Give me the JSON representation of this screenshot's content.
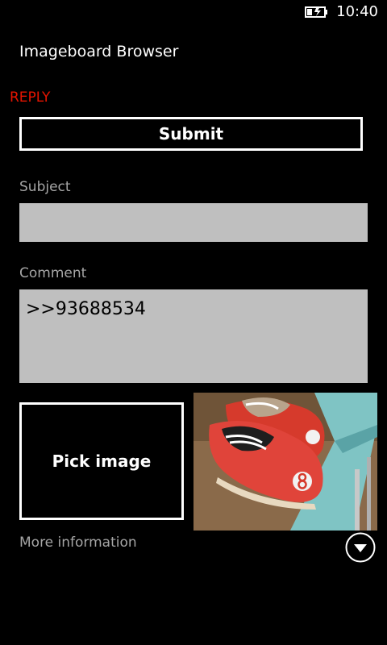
{
  "status_bar": {
    "time": "10:40",
    "battery_icon": "battery-charging-icon"
  },
  "app": {
    "title": "Imageboard Browser"
  },
  "page": {
    "title": "REPLY"
  },
  "form": {
    "submit_label": "Submit",
    "subject_label": "Subject",
    "subject_value": "",
    "comment_label": "Comment",
    "comment_value": ">>93688534",
    "pick_image_label": "Pick image",
    "preview_image_icon": "red-bowling-shoes-photo"
  },
  "footer": {
    "more_info_label": "More information",
    "expand_icon": "chevron-down-circle-icon"
  },
  "colors": {
    "background": "#000000",
    "accent": "#e51400",
    "label_gray": "#a6a6a6",
    "input_bg": "#bfbfbf"
  }
}
